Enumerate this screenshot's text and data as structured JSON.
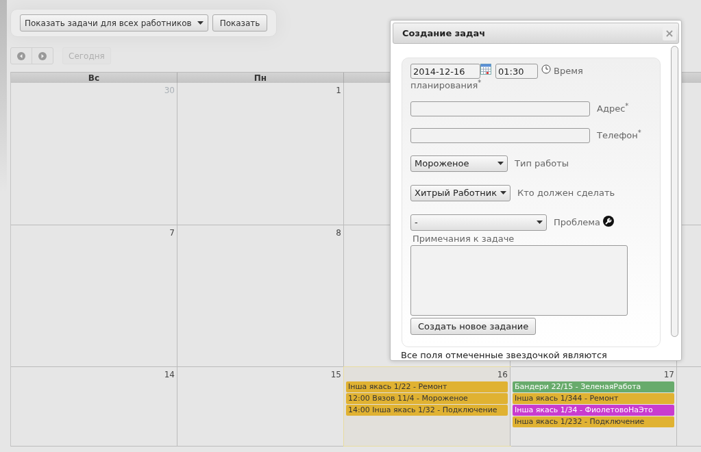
{
  "toolbar": {
    "worker_select": "Показать задачи для всех работников",
    "show_button": "Показать"
  },
  "nav": {
    "today_button": "Сегодня",
    "today_disabled": true
  },
  "calendar": {
    "weekdays": [
      "Вс",
      "Пн"
    ],
    "weeks": [
      {
        "days": [
          {
            "number": "30",
            "other_month": true,
            "today": false
          },
          {
            "number": "1",
            "other_month": false,
            "today": false
          }
        ]
      },
      {
        "days": [
          {
            "number": "7",
            "other_month": false,
            "today": false
          },
          {
            "number": "8",
            "other_month": false,
            "today": false
          }
        ]
      },
      {
        "days": [
          {
            "number": "14",
            "other_month": false,
            "today": false
          },
          {
            "number": "15",
            "other_month": false,
            "today": false
          },
          {
            "number": "16",
            "other_month": false,
            "today": true,
            "events": [
              {
                "text": "Інша якась 1/22 - Ремонт",
                "color": "#e0b232"
              },
              {
                "text": "12:00 Вязов 11/4 - Мороженое",
                "color": "#e0b232"
              },
              {
                "text": "14:00 Інша якась 1/32 - Подключение",
                "color": "#e0b232"
              }
            ]
          },
          {
            "number": "17",
            "other_month": false,
            "today": false,
            "events": [
              {
                "text": "Бандери 22/15 - ЗеленаяРабота",
                "color": "#68ab6c"
              },
              {
                "text": "Інша якась 1/344 - Ремонт",
                "color": "#e0b232"
              },
              {
                "text": "Інша якась 1/34 - ФиолетовоНаЭто",
                "color": "#c93ccf"
              },
              {
                "text": "Інша якась 1/232 - Подключение",
                "color": "#e0b232"
              }
            ]
          }
        ]
      }
    ]
  },
  "dialog": {
    "title": "Создание задач",
    "close": "×",
    "date": "2014-12-16",
    "time": "01:30",
    "time_label_lines": [
      "Время",
      "планирования$^{*}$"
    ],
    "address_label": "Адрес$^{*}$",
    "phone_label": "Телефон$^{*}$",
    "work_type": {
      "value": "Мороженое",
      "label": "Тип работы"
    },
    "worker": {
      "value": "Хитрый Работник",
      "label": "Кто должен сделать"
    },
    "problem": {
      "value": "-",
      "label": "Проблема"
    },
    "notes_label": "Примечания к задаче",
    "submit": "Создать новое задание",
    "footer": "Все поля отмеченные звездочкой являются"
  }
}
